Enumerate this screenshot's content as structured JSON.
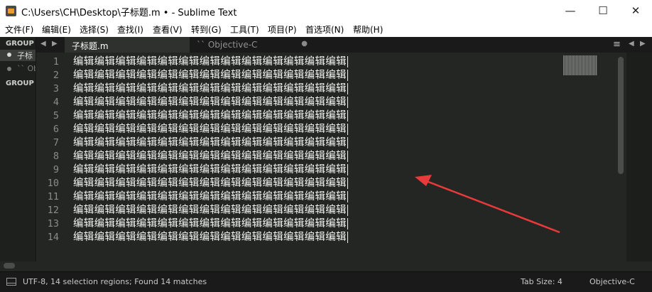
{
  "window": {
    "title": "C:\\Users\\CH\\Desktop\\子标题.m • - Sublime Text",
    "minimize": "—",
    "maximize": "☐",
    "close": "✕"
  },
  "menu": [
    "文件(F)",
    "编辑(E)",
    "选择(S)",
    "查找(I)",
    "查看(V)",
    "转到(G)",
    "工具(T)",
    "项目(P)",
    "首选项(N)",
    "帮助(H)"
  ],
  "sidebar": {
    "group1": "GROUP",
    "group2": "GROUP",
    "files": [
      "子标",
      "`` Ob"
    ]
  },
  "tabs": [
    {
      "label": "子标题.m",
      "active": true
    },
    {
      "label": "`` Objective-C",
      "active": false
    }
  ],
  "editor": {
    "line_numbers": [
      "1",
      "2",
      "3",
      "4",
      "5",
      "6",
      "7",
      "8",
      "9",
      "10",
      "11",
      "12",
      "13",
      "14"
    ],
    "lines": [
      "编辑编辑编辑编辑编辑编辑编辑编辑编辑编辑编辑编辑编辑",
      "编辑编辑编辑编辑编辑编辑编辑编辑编辑编辑编辑编辑编辑",
      "编辑编辑编辑编辑编辑编辑编辑编辑编辑编辑编辑编辑编辑",
      "编辑编辑编辑编辑编辑编辑编辑编辑编辑编辑编辑编辑编辑",
      "编辑编辑编辑编辑编辑编辑编辑编辑编辑编辑编辑编辑编辑",
      "编辑编辑编辑编辑编辑编辑编辑编辑编辑编辑编辑编辑编辑",
      "编辑编辑编辑编辑编辑编辑编辑编辑编辑编辑编辑编辑编辑",
      "编辑编辑编辑编辑编辑编辑编辑编辑编辑编辑编辑编辑编辑",
      "编辑编辑编辑编辑编辑编辑编辑编辑编辑编辑编辑编辑编辑",
      "编辑编辑编辑编辑编辑编辑编辑编辑编辑编辑编辑编辑编辑",
      "编辑编辑编辑编辑编辑编辑编辑编辑编辑编辑编辑编辑编辑",
      "编辑编辑编辑编辑编辑编辑编辑编辑编辑编辑编辑编辑编辑",
      "编辑编辑编辑编辑编辑编辑编辑编辑编辑编辑编辑编辑编辑",
      "编辑编辑编辑编辑编辑编辑编辑编辑编辑编辑编辑编辑编辑"
    ]
  },
  "status": {
    "left": "UTF-8, 14 selection regions; Found 14 matches",
    "tab_size": "Tab Size: 4",
    "syntax": "Objective-C"
  },
  "colors": {
    "editor_bg": "#232623",
    "text": "#f2f2f2",
    "annotation_arrow": "#e83a3a"
  }
}
